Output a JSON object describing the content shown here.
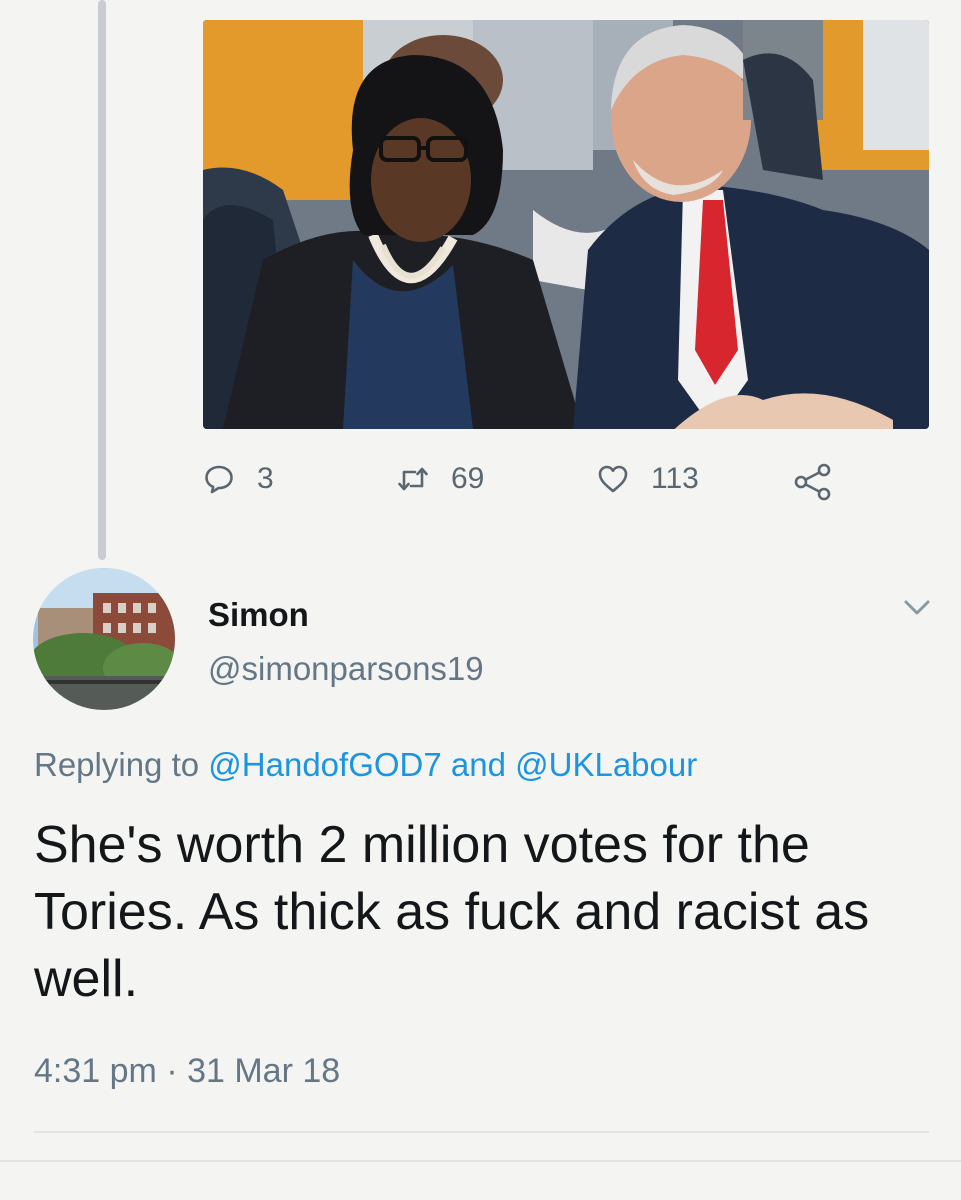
{
  "quoted_tweet": {
    "photo": {
      "alt": ""
    },
    "actions": {
      "reply_count": "3",
      "retweet_count": "69",
      "like_count": "113"
    }
  },
  "tweet": {
    "author": {
      "display_name": "Simon",
      "handle": "@simonparsons19"
    },
    "replying_prefix": "Replying to",
    "replying_to": [
      "@HandofGOD7",
      "@UKLabour"
    ],
    "replying_joiner": "and",
    "text": "She's worth 2 million votes for the Tories. As thick as fuck and racist as well.",
    "time": "4:31 pm",
    "separator": "·",
    "date": "31 Mar 18"
  },
  "icons": {
    "reply": "reply-icon",
    "retweet": "retweet-icon",
    "like": "heart-icon",
    "share": "share-icon",
    "menu": "chevron-down-icon"
  },
  "colors": {
    "background": "#f4f4f2",
    "link": "#1b95e0",
    "secondary_text": "#657786",
    "icon": "#5b6770"
  }
}
